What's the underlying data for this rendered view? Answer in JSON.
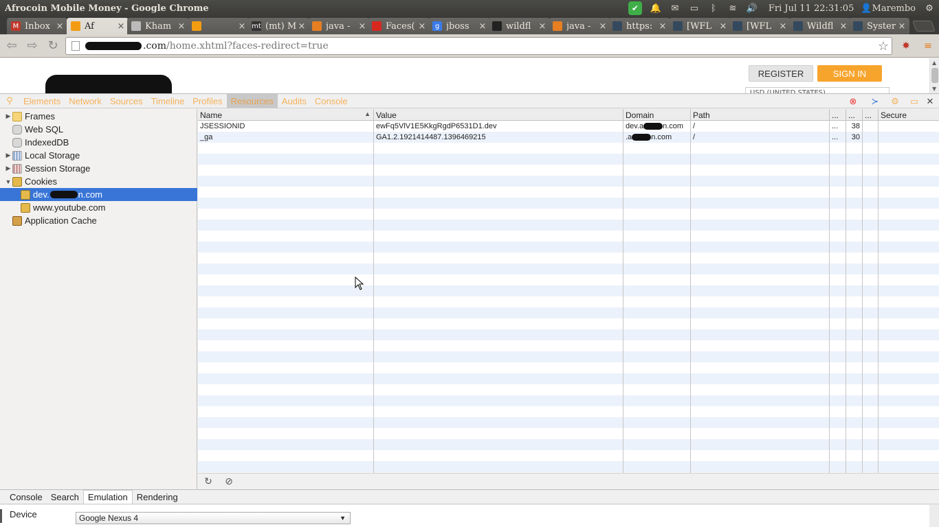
{
  "window": {
    "title": "Afrocoin Mobile Money - Google Chrome",
    "clock": "Fri Jul 11 22:31:05",
    "user": "Marembo"
  },
  "tabs": [
    {
      "label": "Inbox",
      "favicon": "gmail-icon",
      "color": "#c0392b",
      "glyph": "M"
    },
    {
      "label": "Af",
      "favicon": "site-icon",
      "color": "#f39c12",
      "glyph": ""
    },
    {
      "label": "Kham",
      "favicon": "page-icon",
      "color": "#bbbbbb",
      "glyph": ""
    },
    {
      "label": "",
      "favicon": "site-icon",
      "color": "#f39c12",
      "glyph": ""
    },
    {
      "label": "(mt) M",
      "favicon": "mt-icon",
      "color": "#333333",
      "glyph": "mt"
    },
    {
      "label": "java -",
      "favicon": "stackoverflow-icon",
      "color": "#e67e22",
      "glyph": ""
    },
    {
      "label": "Faces(",
      "favicon": "oracle-icon",
      "color": "#d6281f",
      "glyph": ""
    },
    {
      "label": "jboss",
      "favicon": "google-icon",
      "color": "#3b7bea",
      "glyph": "g"
    },
    {
      "label": "wildfl",
      "favicon": "github-icon",
      "color": "#222222",
      "glyph": ""
    },
    {
      "label": "java -",
      "favicon": "stackoverflow-icon",
      "color": "#e67e22",
      "glyph": ""
    },
    {
      "label": "https:",
      "favicon": "jira-icon",
      "color": "#34495e",
      "glyph": ""
    },
    {
      "label": "[WFL",
      "favicon": "jira-icon",
      "color": "#34495e",
      "glyph": ""
    },
    {
      "label": "[WFL",
      "favicon": "jira-icon",
      "color": "#34495e",
      "glyph": ""
    },
    {
      "label": "Wildfl",
      "favicon": "jira-icon",
      "color": "#34495e",
      "glyph": ""
    },
    {
      "label": "Syster",
      "favicon": "jira-icon",
      "color": "#34495e",
      "glyph": ""
    }
  ],
  "omnibox": {
    "host_suffix": ".com",
    "path": "/home.xhtml?faces-redirect=true"
  },
  "page": {
    "register_label": "REGISTER",
    "signin_label": "SIGN IN",
    "currency_text": "USD (UNITED STATES)"
  },
  "devtools": {
    "tabs": [
      "Elements",
      "Network",
      "Sources",
      "Timeline",
      "Profiles",
      "Resources",
      "Audits",
      "Console"
    ],
    "selected_tab": "Resources",
    "tree": [
      {
        "label": "Frames",
        "icon": "folder-icon",
        "expander": "right"
      },
      {
        "label": "Web SQL",
        "icon": "database-icon",
        "expander": ""
      },
      {
        "label": "IndexedDB",
        "icon": "database-icon",
        "expander": ""
      },
      {
        "label": "Local Storage",
        "icon": "storage-icon",
        "expander": "right"
      },
      {
        "label": "Session Storage",
        "icon": "storage-icon",
        "expander": "right"
      },
      {
        "label": "Cookies",
        "icon": "cookie-icon",
        "expander": "down"
      },
      {
        "label_prefix": "dev.",
        "label_suffix": "n.com",
        "icon": "cookie-icon",
        "expander": "",
        "selected": true
      },
      {
        "label": "www.youtube.com",
        "icon": "cookie-icon",
        "expander": ""
      },
      {
        "label": "Application Cache",
        "icon": "appcache-icon",
        "expander": ""
      }
    ],
    "columns": [
      "Name",
      "Value",
      "Domain",
      "Path",
      "...",
      "...",
      "...",
      "Secure"
    ],
    "rows": [
      {
        "name": "JSESSIONID",
        "value": "ewFq5VlV1E5KkgRgdP6531D1.dev",
        "domain_prefix": "dev.a",
        "domain_suffix": "n.com",
        "path": "/",
        "c5": "...",
        "c6": "38"
      },
      {
        "name": "_ga",
        "value": "GA1.2.1921414487.1396469215",
        "domain_prefix": ".a",
        "domain_suffix": "n.com",
        "path": "/",
        "c5": "...",
        "c6": "30"
      }
    ],
    "drawer_tabs": [
      "Console",
      "Search",
      "Emulation",
      "Rendering"
    ],
    "selected_drawer_tab": "Emulation",
    "device_label": "Device",
    "device_value": "Google Nexus 4"
  }
}
